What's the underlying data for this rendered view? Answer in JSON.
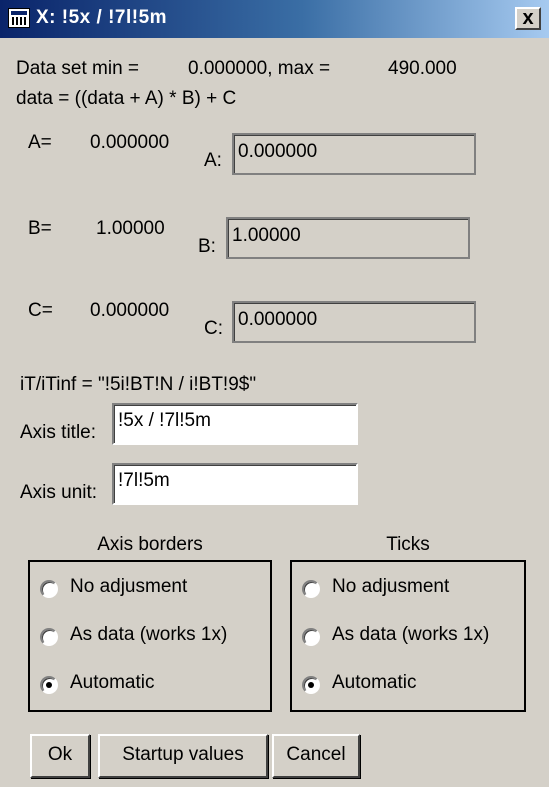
{
  "window": {
    "title": "X: !5x / !7l!5m",
    "close_label": "x"
  },
  "info": {
    "range_label": "Data set min =",
    "min_value": "0.000000, max =",
    "max_value": "490.000",
    "formula": "data = ((data + A) * B) + C"
  },
  "params": {
    "a": {
      "label": "A=",
      "value": "0.000000",
      "field_label": "A:",
      "field_value": "0.000000"
    },
    "b": {
      "label": "B=",
      "value": "1.00000",
      "field_label": "B:",
      "field_value": "1.00000"
    },
    "c": {
      "label": "C=",
      "value": "0.000000",
      "field_label": "C:",
      "field_value": "0.000000"
    }
  },
  "tinf_text": "iT/iTinf = \"!5i!BT!N / i!BT!9$\"",
  "axis_title": {
    "label": "Axis title:",
    "value": "!5x / !7l!5m"
  },
  "axis_unit": {
    "label": "Axis unit:",
    "value": "!7l!5m"
  },
  "axis_borders": {
    "title": "Axis borders",
    "options": [
      "No adjusment",
      "As data (works 1x)",
      "Automatic"
    ],
    "selected": "Automatic"
  },
  "ticks": {
    "title": "Ticks",
    "options": [
      "No adjusment",
      "As data (works 1x)",
      "Automatic"
    ],
    "selected": "Automatic"
  },
  "buttons": {
    "ok": "Ok",
    "startup": "Startup values",
    "cancel": "Cancel"
  }
}
